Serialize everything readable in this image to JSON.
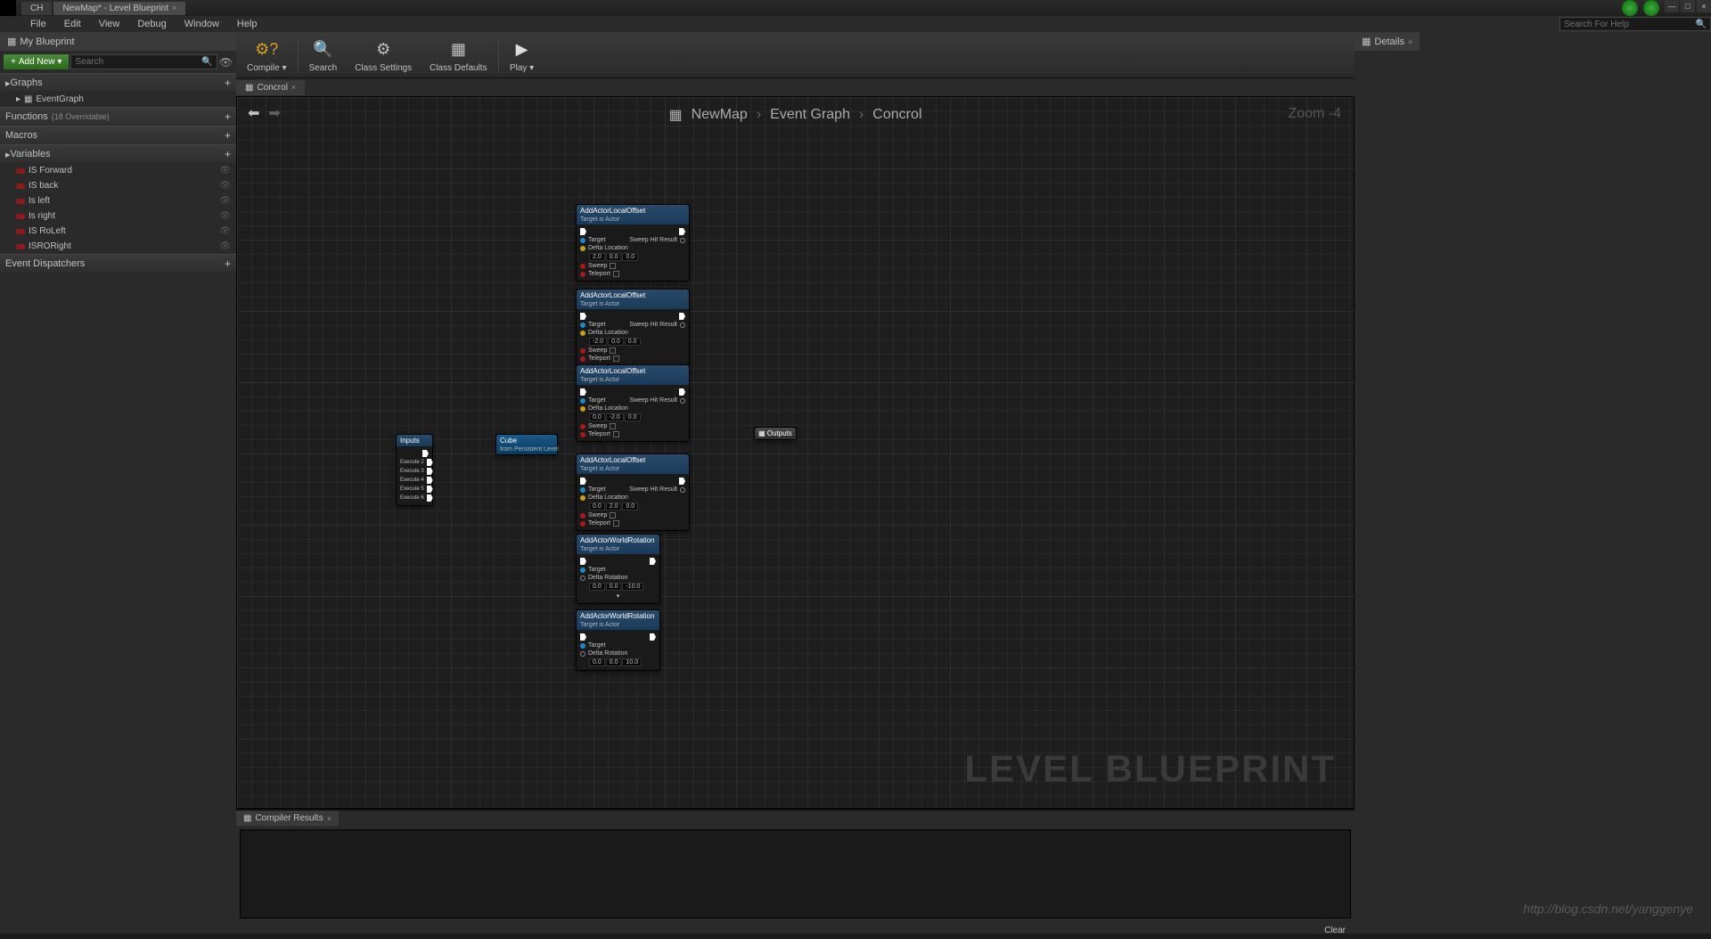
{
  "titlebar": {
    "tabs": [
      {
        "label": "CH"
      },
      {
        "label": "NewMap* - Level Blueprint"
      }
    ]
  },
  "menubar": {
    "items": [
      "File",
      "Edit",
      "View",
      "Debug",
      "Window",
      "Help"
    ],
    "search_placeholder": "Search For Help"
  },
  "left": {
    "panel_title": "My Blueprint",
    "add_new": "Add New",
    "search_placeholder": "Search",
    "sections": {
      "graphs": "Graphs",
      "eventgraph": "EventGraph",
      "functions": "Functions",
      "functions_sub": "(18 Overridable)",
      "macros": "Macros",
      "variables": "Variables",
      "dispatchers": "Event Dispatchers"
    },
    "variables": [
      "IS Forward",
      "IS back",
      "Is left",
      "Is right",
      "IS RoLeft",
      "ISRORight"
    ]
  },
  "toolbar": {
    "compile": "Compile",
    "search": "Search",
    "class_settings": "Class Settings",
    "class_defaults": "Class Defaults",
    "play": "Play"
  },
  "graph": {
    "tab": "Concrol",
    "breadcrumb": [
      "NewMap",
      "Event Graph",
      "Concrol"
    ],
    "zoom": "Zoom -4",
    "watermark": "LEVEL BLUEPRINT",
    "inputs_node": {
      "title": "Inputs",
      "pins": [
        "Execute 2",
        "Execute 3",
        "Execute 4",
        "Execute 5",
        "Execute 6"
      ]
    },
    "cube_node": {
      "title": "Cube",
      "sub": "from Persistent Level"
    },
    "outputs_node": "Outputs",
    "offset_nodes": [
      {
        "title": "AddActorLocalOffset",
        "vec": [
          "2.0",
          "0.0",
          "0.0"
        ]
      },
      {
        "title": "AddActorLocalOffset",
        "vec": [
          "-2.0",
          "0.0",
          "0.0"
        ]
      },
      {
        "title": "AddActorLocalOffset",
        "vec": [
          "0.0",
          "-2.0",
          "0.0"
        ]
      },
      {
        "title": "AddActorLocalOffset",
        "vec": [
          "0.0",
          "2.0",
          "0.0"
        ]
      }
    ],
    "rotation_nodes": [
      {
        "title": "AddActorWorldRotation",
        "vec": [
          "0.0",
          "0.0",
          "-10.0"
        ]
      },
      {
        "title": "AddActorWorldRotation",
        "vec": [
          "0.0",
          "0.0",
          "10.0"
        ]
      }
    ],
    "pin_labels": {
      "target": "Target",
      "delta_loc": "Delta Location",
      "delta_rot": "Delta Rotation",
      "sweep": "Sweep",
      "teleport": "Teleport",
      "sweep_hit": "Sweep Hit Result",
      "target_sub": "Target is Actor"
    }
  },
  "compiler": {
    "title": "Compiler Results",
    "clear": "Clear"
  },
  "details": {
    "title": "Details"
  },
  "url_watermark": "http://blog.csdn.net/yanggenye"
}
